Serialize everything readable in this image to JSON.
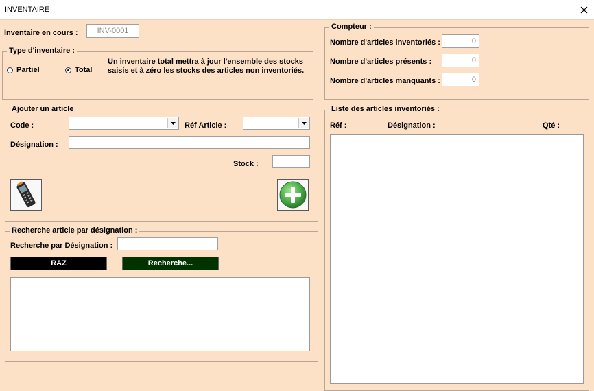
{
  "window": {
    "title": "INVENTAIRE"
  },
  "inventory": {
    "label": "Inventaire en cours :",
    "value": "INV-0001"
  },
  "type": {
    "title": "Type d'inventaire :",
    "partial_label": "Partiel",
    "total_label": "Total",
    "selected": "total",
    "info_line1": "Un inventaire total mettra à jour l'ensemble des stocks",
    "info_line2": "saisis et à zéro les stocks des articles non inventoriés."
  },
  "counter": {
    "title": "Compteur :",
    "inventoried_label": "Nombre d'articles inventoriés :",
    "inventoried_value": "0",
    "present_label": "Nombre d'articles présents :",
    "present_value": "0",
    "missing_label": "Nombre d'articles manquants :",
    "missing_value": "0"
  },
  "add_article": {
    "title": "Ajouter un article",
    "code_label": "Code :",
    "code_value": "",
    "ref_label": "Réf Article :",
    "ref_value": "",
    "designation_label": "Désignation :",
    "designation_value": "",
    "stock_label": "Stock :",
    "stock_value": ""
  },
  "search": {
    "title": "Recherche article par désignation :",
    "label": "Recherche  par Désignation :",
    "value": "",
    "raz_label": "RAZ",
    "search_label": "Recherche..."
  },
  "list": {
    "title": "Liste des articles inventoriés :",
    "col_ref": "Réf :",
    "col_designation": "Désignation :",
    "col_qty": "Qté :"
  },
  "colors": {
    "background": "#fde1c6",
    "raz_button": "#000000",
    "search_button": "#003300",
    "add_icon": "#4cb04c"
  },
  "icons": {
    "close": "close-icon",
    "scanner": "barcode-scanner-icon",
    "add": "plus-circle-icon"
  }
}
